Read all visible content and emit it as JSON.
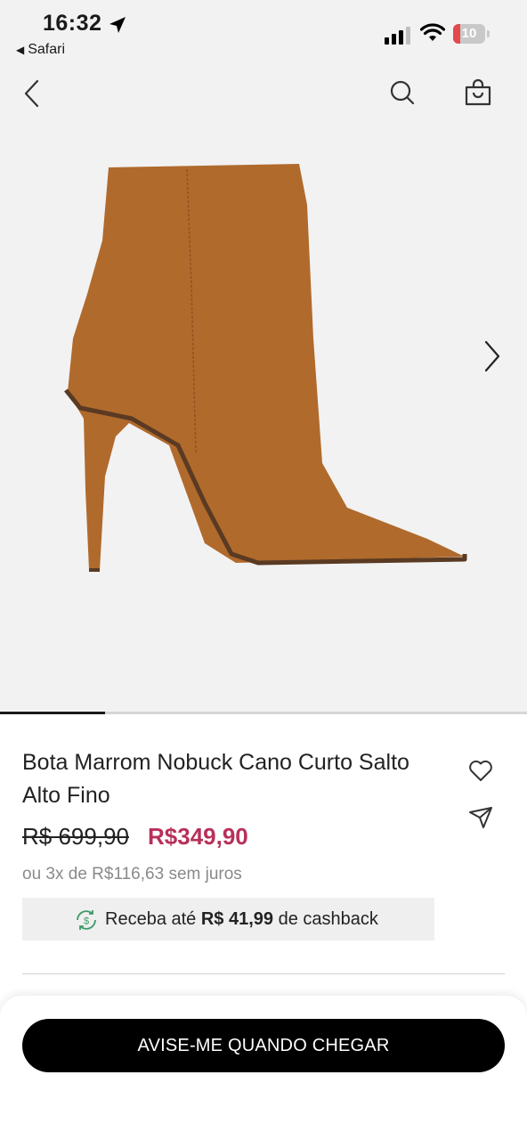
{
  "status_bar": {
    "time": "16:32",
    "back_app": "Safari",
    "battery": "10"
  },
  "icons": {
    "back": "chevron-left-icon",
    "search": "search-icon",
    "bag": "shopping-bag-icon",
    "next": "chevron-right-icon",
    "favorite": "heart-icon",
    "share": "send-icon",
    "cashback": "cashback-dollar-icon"
  },
  "carousel": {
    "progress": 0.2
  },
  "product": {
    "title": "Bota Marrom Nobuck Cano Curto Salto Alto Fino",
    "old_price": "R$ 699,90",
    "price": "R$349,90",
    "installments": "ou 3x de R$116,63 sem juros",
    "cashback": {
      "prefix": "Receba até",
      "amount": "R$ 41,99",
      "suffix": "de cashback"
    }
  },
  "cta": {
    "label": "AVISE-ME QUANDO CHEGAR"
  },
  "colors": {
    "accent_price": "#b8305a",
    "cta_bg": "#000000",
    "boot": "#b06a2c",
    "hero_bg": "#f2f2f2"
  }
}
